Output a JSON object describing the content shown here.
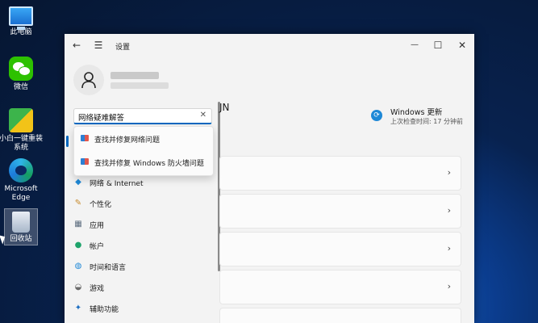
{
  "desktop": {
    "icons": [
      {
        "label": "此电脑",
        "icon": "pc-icon"
      },
      {
        "label": "微信",
        "icon": "wechat-icon"
      },
      {
        "label": "小白一键重装系统",
        "icon": "installer-icon"
      },
      {
        "label": "Microsoft Edge",
        "icon": "edge-icon"
      },
      {
        "label": "回收站",
        "icon": "recycle-bin-icon"
      }
    ]
  },
  "window": {
    "title": "设置",
    "controls": {
      "back": "←",
      "menu": "☰",
      "minimize": "—",
      "maximize": "☐",
      "close": "✕"
    }
  },
  "search": {
    "value": "网络疑难解答",
    "clear": "✕",
    "suggestions": [
      {
        "label": "查找并修复网络问题"
      },
      {
        "label": "查找并修复 Windows 防火墙问题"
      }
    ]
  },
  "nav": {
    "items": [
      {
        "label": "网络 & Internet",
        "icon": "wifi-icon",
        "glyph": "◆",
        "color": "#1e88d6"
      },
      {
        "label": "个性化",
        "icon": "brush-icon",
        "glyph": "✎",
        "color": "#c78a2c"
      },
      {
        "label": "应用",
        "icon": "apps-icon",
        "glyph": "▦",
        "color": "#5a6b7d"
      },
      {
        "label": "帐户",
        "icon": "account-icon",
        "glyph": "●",
        "color": "#1ea36b"
      },
      {
        "label": "时间和语言",
        "icon": "globe-clock-icon",
        "glyph": "◍",
        "color": "#1e88d6"
      },
      {
        "label": "游戏",
        "icon": "controller-icon",
        "glyph": "◒",
        "color": "#6b6b6b"
      },
      {
        "label": "辅助功能",
        "icon": "accessibility-icon",
        "glyph": "✦",
        "color": "#1e6fc2"
      }
    ]
  },
  "main": {
    "heading_fragment": "JN",
    "update": {
      "title": "Windows 更新",
      "subtitle": "上次检查时间: 17 分钟前",
      "icon": "sync-icon"
    },
    "card_chevron": "›"
  },
  "colors": {
    "accent": "#0067c0"
  }
}
